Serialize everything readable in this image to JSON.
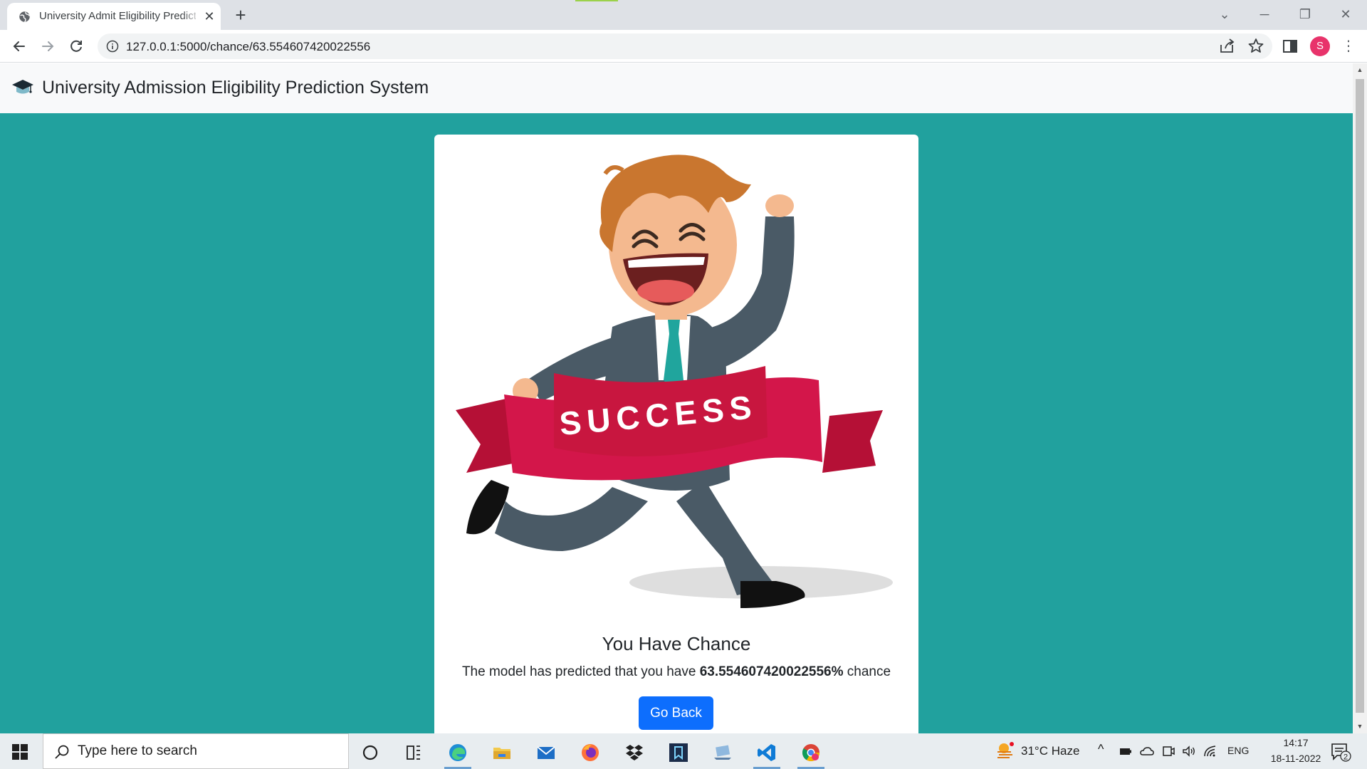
{
  "browser": {
    "tab_title": "University Admit Eligibility Prediction System",
    "url": "127.0.0.1:5000/chance/63.554607420022556",
    "profile_initial": "S"
  },
  "navbar": {
    "brand": "University Admission Eligibility Prediction System"
  },
  "result": {
    "banner_text": "SUCCESS",
    "title": "You Have Chance",
    "text_prefix": "The model has predicted that you have ",
    "chance_value": "63.554607420022556%",
    "text_suffix": " chance",
    "button_label": "Go Back"
  },
  "taskbar": {
    "search_placeholder": "Type here to search",
    "weather": "31°C  Haze",
    "language": "ENG",
    "time": "14:17",
    "date": "18-11-2022",
    "notification_count": "2"
  },
  "colors": {
    "page_background": "#21a19e",
    "button": "#0d6efd",
    "banner": "#c8163f"
  }
}
